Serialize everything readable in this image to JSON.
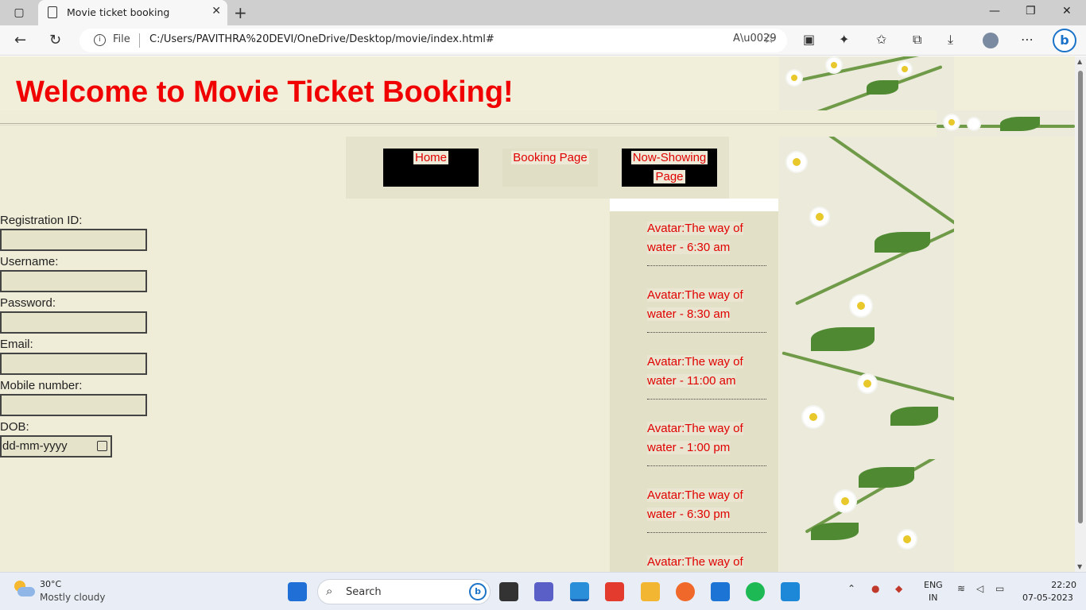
{
  "browser": {
    "tab_title": "Movie ticket booking",
    "address_scheme": "File",
    "address_url": "C:/Users/PAVITHRA%20DEVI/OneDrive/Desktop/movie/index.html#"
  },
  "page": {
    "heading": "Welcome to Movie Ticket Booking!",
    "nav": {
      "home": "Home",
      "booking": "Booking Page",
      "now_showing_line1": "Now-Showing",
      "now_showing_line2": "Page"
    },
    "form": {
      "registration_label": "Registration ID:",
      "username_label": "Username:",
      "password_label": "Password:",
      "email_label": "Email:",
      "mobile_label": "Mobile number:",
      "dob_label": "DOB:",
      "dob_placeholder": "dd-mm-yyyy"
    },
    "showtimes": [
      {
        "line1": "Avatar:The way of",
        "line2": "water - 6:30 am"
      },
      {
        "line1": "Avatar:The way of",
        "line2": "water - 8:30 am"
      },
      {
        "line1": "Avatar:The way of",
        "line2": "water - 11:00 am"
      },
      {
        "line1": "Avatar:The way of",
        "line2": "water - 1:00 pm"
      },
      {
        "line1": "Avatar:The way of",
        "line2": "water - 6:30 pm"
      },
      {
        "line1": "Avatar:The way of",
        "line2": ""
      }
    ]
  },
  "taskbar": {
    "temperature": "30°C",
    "condition": "Mostly cloudy",
    "search_label": "Search",
    "lang_line1": "ENG",
    "lang_line2": "IN",
    "time": "22:20",
    "date": "07-05-2023"
  },
  "colors": {
    "heading": "#f00000",
    "nav_text": "#e00000",
    "page_bg": "#efecd8"
  }
}
